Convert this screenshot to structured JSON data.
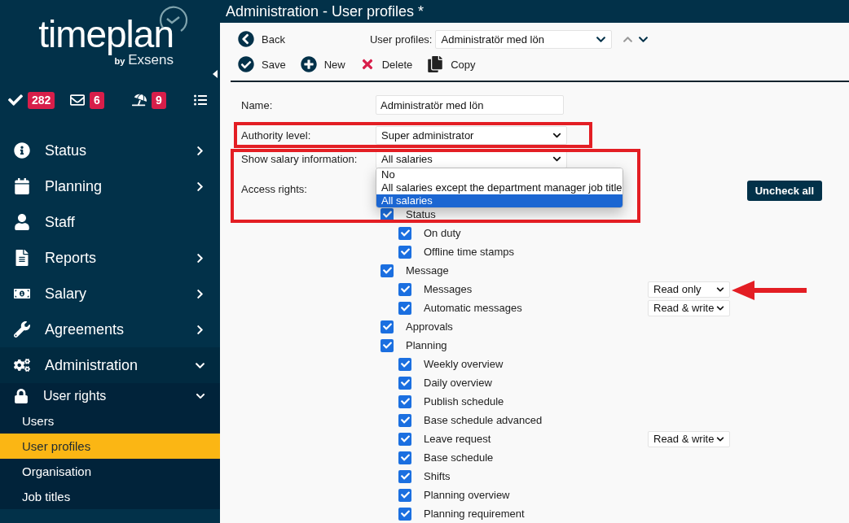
{
  "sidebar": {
    "logo": {
      "wordmark": "timeplan",
      "byline": "by",
      "brand": "Exsens"
    },
    "badges": [
      {
        "kind": "approvals",
        "count": "282"
      },
      {
        "kind": "messages",
        "count": "6"
      },
      {
        "kind": "leave",
        "count": "9"
      }
    ],
    "items": [
      {
        "kind": "info",
        "label": "Status",
        "has_submenu": true,
        "expanded": false
      },
      {
        "kind": "calendar",
        "label": "Planning",
        "has_submenu": true,
        "expanded": false
      },
      {
        "kind": "person",
        "label": "Staff",
        "has_submenu": false
      },
      {
        "kind": "document",
        "label": "Reports",
        "has_submenu": true,
        "expanded": false
      },
      {
        "kind": "money",
        "label": "Salary",
        "has_submenu": true,
        "expanded": false
      },
      {
        "kind": "wrench",
        "label": "Agreements",
        "has_submenu": true,
        "expanded": false
      },
      {
        "kind": "gears",
        "label": "Administration",
        "has_submenu": true,
        "expanded": true,
        "children": [
          {
            "kind": "lock",
            "label": "User rights",
            "expanded": true,
            "children": [
              {
                "label": "Users",
                "selected": false
              },
              {
                "label": "User profiles",
                "selected": true
              },
              {
                "label": "Organisation",
                "selected": false
              },
              {
                "label": "Job titles",
                "selected": false
              }
            ]
          }
        ]
      }
    ]
  },
  "header": {
    "title": "Administration - User profiles *"
  },
  "toolbar": {
    "back": "Back",
    "profile_selector": {
      "label": "User profiles:",
      "value": "Administratör med lön"
    },
    "actions": [
      {
        "kind": "save",
        "label": "Save"
      },
      {
        "kind": "new",
        "label": "New"
      },
      {
        "kind": "delete",
        "label": "Delete"
      },
      {
        "kind": "copy",
        "label": "Copy"
      }
    ]
  },
  "form": {
    "name": {
      "label": "Name:",
      "value": "Administratör med lön"
    },
    "authority": {
      "label": "Authority level:",
      "value": "Super administrator",
      "highlighted": true
    },
    "salary": {
      "label": "Show salary information:",
      "value": "All salaries",
      "highlighted": true,
      "open": true,
      "options": [
        {
          "label": "No",
          "selected": false
        },
        {
          "label": "All salaries except the department manager job title",
          "selected": false
        },
        {
          "label": "All salaries",
          "selected": true
        }
      ]
    }
  },
  "access_rights": {
    "label": "Access rights:",
    "uncheck_all": "Uncheck all",
    "items": [
      {
        "label": "Status",
        "checked": true,
        "children": [
          {
            "label": "On duty",
            "checked": true
          },
          {
            "label": "Offline time stamps",
            "checked": true
          }
        ]
      },
      {
        "label": "Message",
        "checked": true,
        "children": [
          {
            "label": "Messages",
            "checked": true,
            "permission": "Read only",
            "annotated": true
          },
          {
            "label": "Automatic messages",
            "checked": true,
            "permission": "Read & write"
          }
        ]
      },
      {
        "label": "Approvals",
        "checked": true
      },
      {
        "label": "Planning",
        "checked": true,
        "children": [
          {
            "label": "Weekly overview",
            "checked": true
          },
          {
            "label": "Daily overview",
            "checked": true
          },
          {
            "label": "Publish schedule",
            "checked": true
          },
          {
            "label": "Base schedule advanced",
            "checked": true
          },
          {
            "label": "Leave request",
            "checked": true,
            "permission": "Read & write"
          },
          {
            "label": "Base schedule",
            "checked": true
          },
          {
            "label": "Shifts",
            "checked": true
          },
          {
            "label": "Planning overview",
            "checked": true
          },
          {
            "label": "Planning requirement",
            "checked": true
          }
        ]
      }
    ]
  }
}
